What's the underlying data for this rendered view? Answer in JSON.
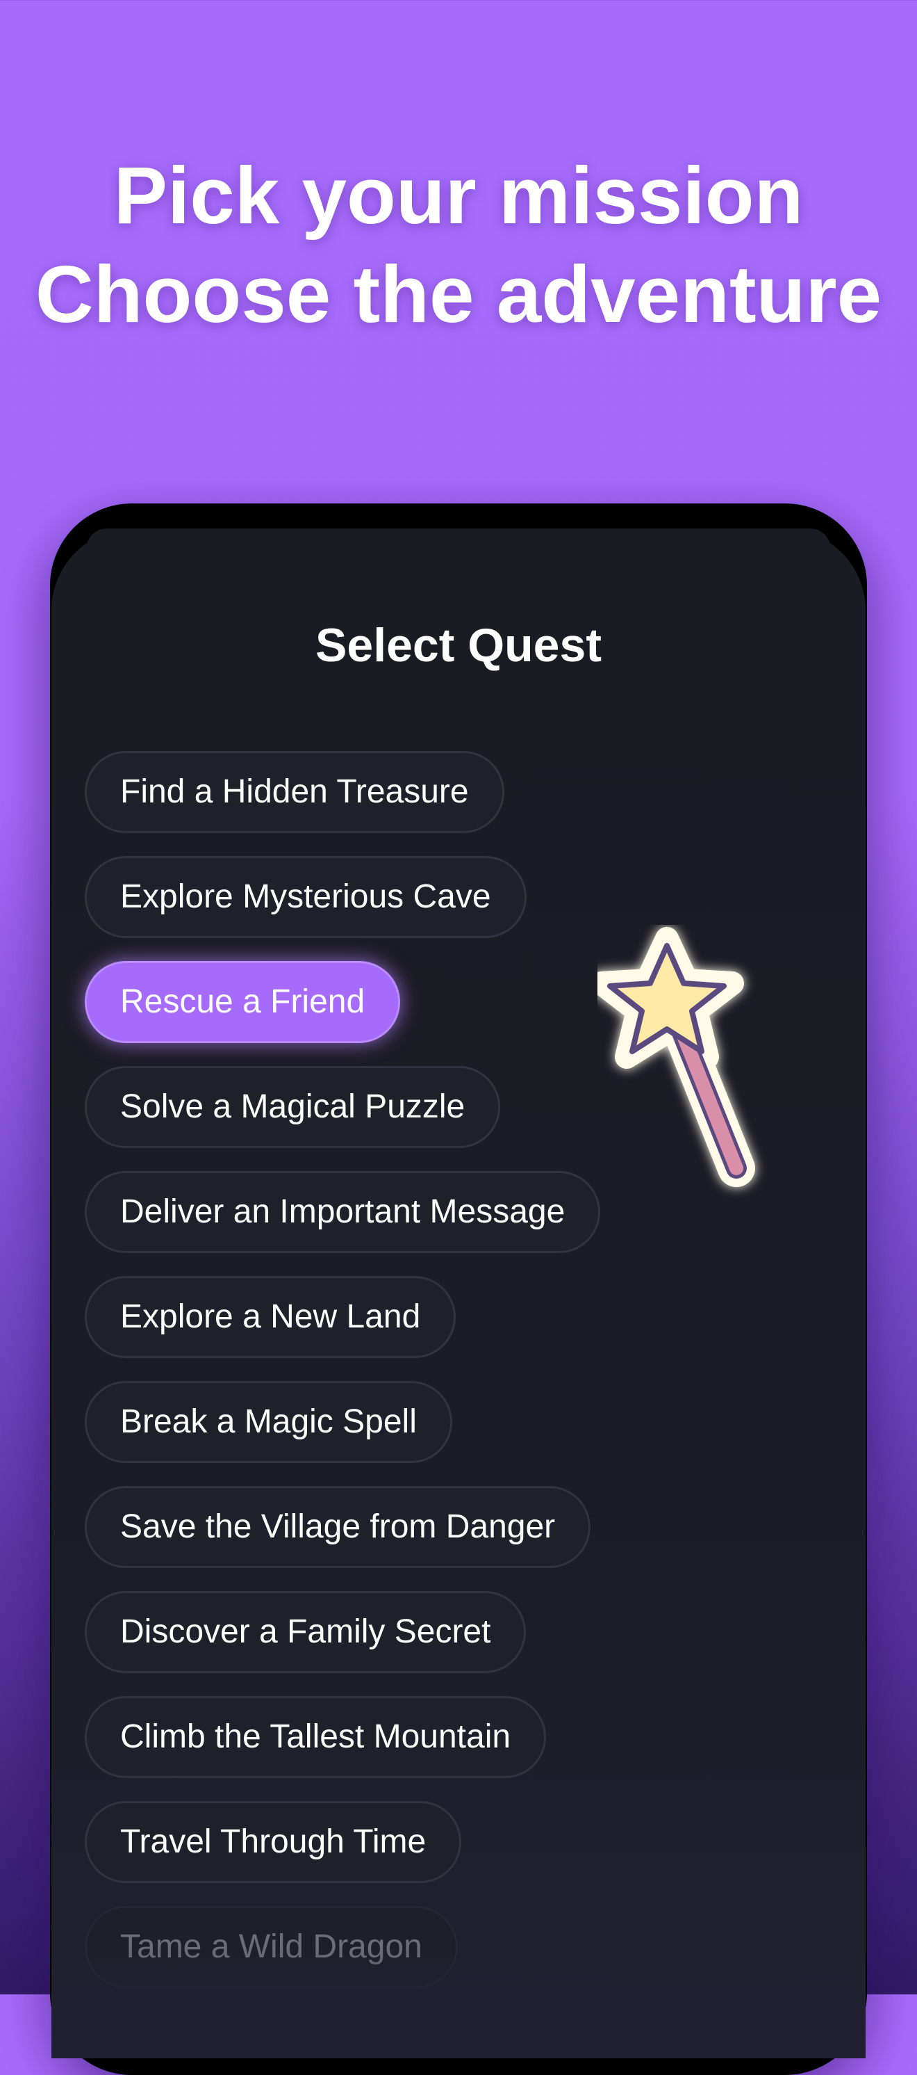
{
  "headline": {
    "line1": "Pick your mission",
    "line2": "Choose the adventure"
  },
  "screen": {
    "title": "Select Quest"
  },
  "quests": [
    {
      "label": "Find a Hidden Treasure",
      "selected": false
    },
    {
      "label": "Explore Mysterious Cave",
      "selected": false
    },
    {
      "label": "Rescue a Friend",
      "selected": true
    },
    {
      "label": "Solve a Magical Puzzle",
      "selected": false
    },
    {
      "label": "Deliver an Important Message",
      "selected": false
    },
    {
      "label": "Explore a New Land",
      "selected": false
    },
    {
      "label": "Break a Magic Spell",
      "selected": false
    },
    {
      "label": "Save the Village from Danger",
      "selected": false
    },
    {
      "label": "Discover a Family Secret",
      "selected": false
    },
    {
      "label": "Climb the Tallest Mountain",
      "selected": false
    },
    {
      "label": "Travel Through Time",
      "selected": false
    },
    {
      "label": "Tame a Wild Dragon",
      "selected": false
    }
  ],
  "colors": {
    "background": "#a66bfb",
    "accent": "#a66bfb",
    "screen": "#1b1b24",
    "chip": "#20202a",
    "chip_border": "#33333f"
  },
  "icons": {
    "decoration": "magic-wand-icon"
  }
}
